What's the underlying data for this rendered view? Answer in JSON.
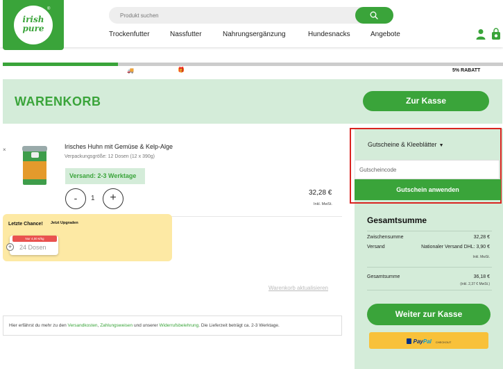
{
  "header": {
    "logo_text_line1": "irish",
    "logo_text_line2": "pure",
    "logo_reg": "®",
    "search_placeholder": "Produkt suchen",
    "nav": [
      "Trockenfutter",
      "Nassfutter",
      "Nahrungsergänzung",
      "Hundesnacks",
      "Angebote"
    ]
  },
  "progress": {
    "value_percent": 23,
    "reward_label": "5% RABATT"
  },
  "cart": {
    "title": "WARENKORB",
    "checkout_label": "Zur Kasse",
    "remove_label": "×",
    "item": {
      "name": "Irisches Huhn mit Gemüse & Kelp-Alge",
      "packaging": "Verpackungsgröße: 12 Dosen (12 x 390g)",
      "shipping": "Versand: 2-3 Werktage",
      "quantity": "1",
      "minus": "-",
      "plus": "+",
      "price": "32,28 €",
      "vat_note": "Inkl. MwSt."
    },
    "upgrade": {
      "title": "Letzte Chance!",
      "subtitle": "Jetzt Upgraden",
      "badge": "Nur 4,00 €/kg",
      "plus": "+",
      "option": "24 Dosen"
    },
    "update_link": "Warenkorb aktualisieren",
    "info": {
      "prefix": "Hier erfährst du mehr zu den ",
      "link1": "Versandkosten",
      "sep1": ", ",
      "link2": "Zahlungsweisen",
      "mid": " und unserer ",
      "link3": "Widerrufsbelehrung",
      "suffix": ". Die Lieferzeit beträgt ca. 2-3 Werktage."
    }
  },
  "sidebar": {
    "coupon_toggle": "Gutscheine & Kleeblätter",
    "coupon_placeholder": "Gutscheincode",
    "coupon_button": "Gutschein anwenden",
    "total_title": "Gesamtsumme",
    "subtotal_label": "Zwischensumme",
    "subtotal_value": "32,28 €",
    "shipping_label": "Versand",
    "shipping_value": "Nationaler Versand DHL: 3,90 €",
    "shipping_vat": "Inkl. MwSt.",
    "total_label": "Gesamtsumme",
    "total_value": "36,18 €",
    "total_vat": "(inkl. 2,37 € MwSt.)",
    "checkout_button": "Weiter zur Kasse",
    "paypal_a": "Pay",
    "paypal_b": "Pal",
    "paypal_checkout": "CHECKOUT"
  },
  "colors": {
    "brand_green": "#3aa43a",
    "light_green": "#d4ecd9",
    "highlight_red": "#d9231f",
    "upgrade_yellow": "#fde9a4",
    "paypal_yellow": "#f8c13a"
  },
  "icons": {
    "search": "search-icon",
    "user": "user-icon",
    "cart": "cart-icon",
    "truck": "truck-icon",
    "gift": "gift-icon",
    "chevron": "chevron-down-icon"
  }
}
